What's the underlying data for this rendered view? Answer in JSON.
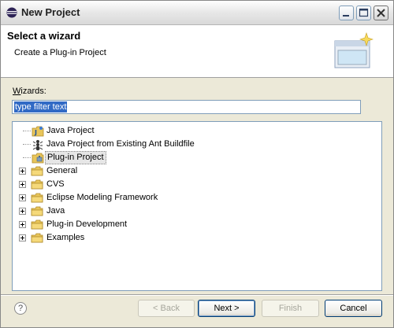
{
  "window": {
    "title": "New Project"
  },
  "header": {
    "title": "Select a wizard",
    "description": "Create a Plug-in Project"
  },
  "wizards": {
    "label_prefix": "W",
    "label_rest": "izards:",
    "filter_text": "type filter text"
  },
  "tree": {
    "items": [
      {
        "label": "Java Project",
        "icon": "java-project-icon",
        "expandable": false
      },
      {
        "label": "Java Project from Existing Ant Buildfile",
        "icon": "ant-icon",
        "expandable": false
      },
      {
        "label": "Plug-in Project",
        "icon": "plugin-project-icon",
        "expandable": false,
        "selected": true
      },
      {
        "label": "General",
        "icon": "folder-icon",
        "expandable": true
      },
      {
        "label": "CVS",
        "icon": "folder-icon",
        "expandable": true
      },
      {
        "label": "Eclipse Modeling Framework",
        "icon": "folder-icon",
        "expandable": true
      },
      {
        "label": "Java",
        "icon": "folder-icon",
        "expandable": true
      },
      {
        "label": "Plug-in Development",
        "icon": "folder-icon",
        "expandable": true
      },
      {
        "label": "Examples",
        "icon": "folder-icon",
        "expandable": true
      }
    ]
  },
  "footer": {
    "help": "?",
    "back": "< Back",
    "next": "Next >",
    "finish": "Finish",
    "cancel": "Cancel"
  }
}
